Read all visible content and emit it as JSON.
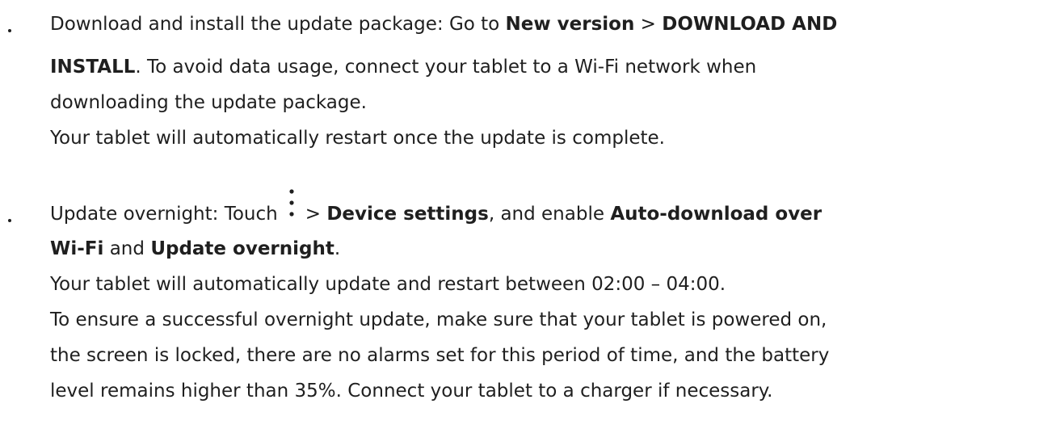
{
  "bullet1": {
    "intro": "Download and install the update package: Go to ",
    "b1": "New version",
    "sep": " > ",
    "b2a": "DOWNLOAD AND",
    "b2b": "INSTALL",
    "rest1": ". To avoid data usage, connect your tablet to a Wi-Fi network when",
    "line3": "downloading the update package.",
    "line4": "Your tablet will automatically restart once the update is complete."
  },
  "bullet2": {
    "intro": "Update overnight: Touch",
    "icon": "more-vertical-icon",
    "sep": "> ",
    "b1": "Device settings",
    "mid": ", and enable ",
    "b2a": "Auto-download over",
    "b2b": "Wi-Fi",
    "and": " and ",
    "b3": "Update overnight",
    "period": ".",
    "line3": "Your tablet will automatically update and restart between 02:00 – 04:00.",
    "line4": "To ensure a successful overnight update, make sure that your tablet is powered on,",
    "line5": "the screen is locked, there are no alarms set for this period of time, and the battery",
    "line6": "level remains higher than 35%. Connect your tablet to a charger if necessary."
  }
}
